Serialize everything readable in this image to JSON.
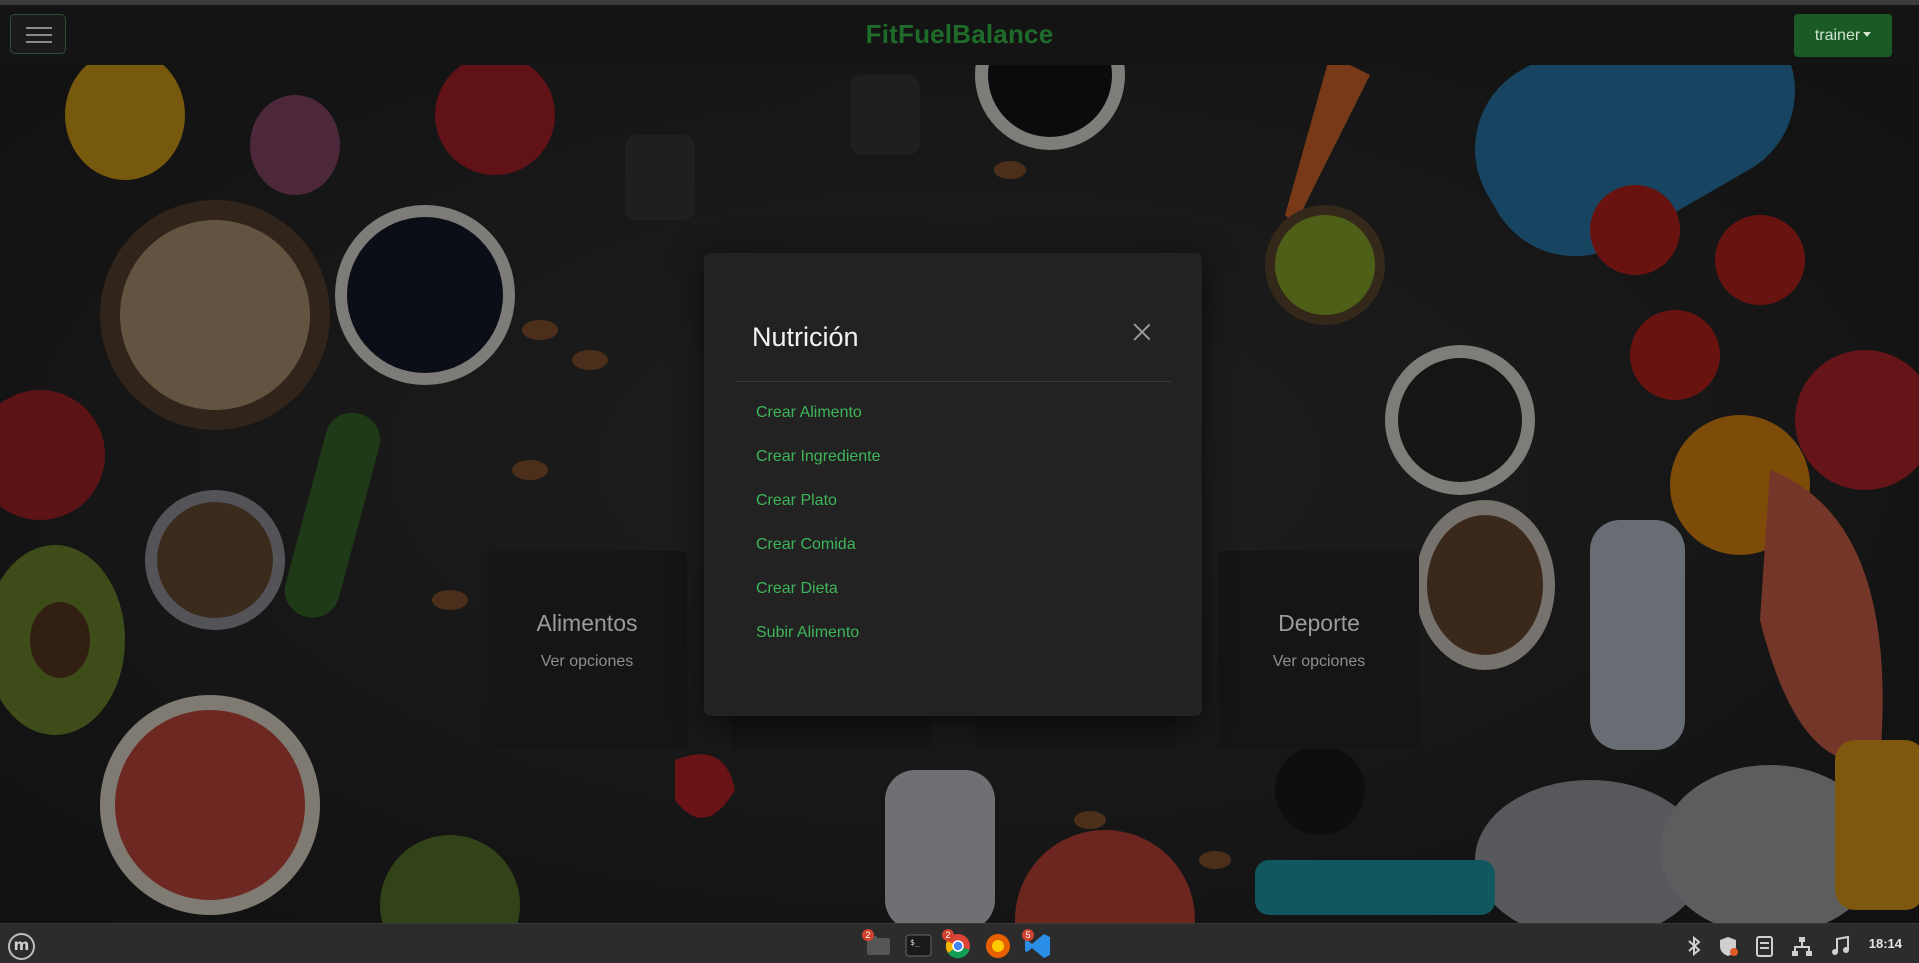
{
  "navbar": {
    "brand": "FitFuelBalance",
    "user_menu_label": "trainer"
  },
  "cards": [
    {
      "title": "Alimentos",
      "link": "Ver opciones"
    },
    {
      "title": "Deporte",
      "link": "Ver opciones"
    }
  ],
  "modal": {
    "title": "Nutrición",
    "items": [
      {
        "label": "Crear Alimento"
      },
      {
        "label": "Crear Ingrediente"
      },
      {
        "label": "Crear Plato"
      },
      {
        "label": "Crear Comida"
      },
      {
        "label": "Crear Dieta"
      },
      {
        "label": "Subir Alimento"
      }
    ]
  },
  "taskbar": {
    "apps": [
      {
        "icon": "files-icon",
        "badge": "2"
      },
      {
        "icon": "terminal-icon",
        "badge": ""
      },
      {
        "icon": "chrome-icon",
        "badge": "2"
      },
      {
        "icon": "firefox-icon",
        "badge": ""
      },
      {
        "icon": "vscode-icon",
        "badge": "5"
      }
    ],
    "tray": [
      "bluetooth-icon",
      "shield-icon",
      "notes-icon",
      "network-icon",
      "sound-icon"
    ],
    "clock": "18:14"
  },
  "colors": {
    "brand": "#1e6b2a",
    "user_button": "#1a5b25",
    "modal_link": "#3fb559",
    "modal_bg": "#222222"
  }
}
